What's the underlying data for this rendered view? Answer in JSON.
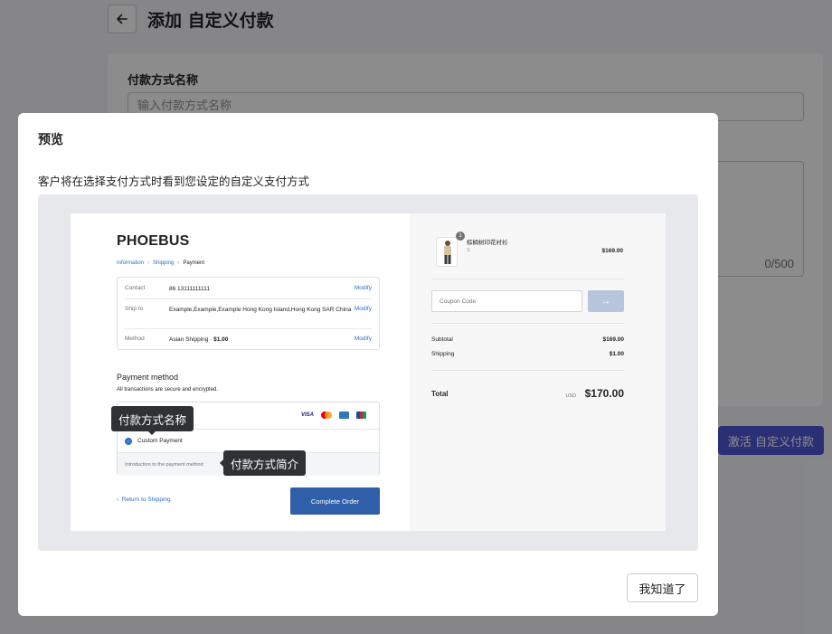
{
  "page": {
    "title": "添加 自定义付款",
    "back_icon": "arrow-left-icon",
    "field_name_label": "付款方式名称",
    "field_name_placeholder": "输入付款方式名称",
    "char_count": "0/500",
    "activate_label": "激活 自定义付款",
    "accent": "#4f57d6"
  },
  "modal": {
    "title": "预览",
    "description": "客户将在选择支付方式时看到您设定的自定义支付方式",
    "ok_label": "我知道了"
  },
  "checkout": {
    "brand": "PHOEBUS",
    "breadcrumb": {
      "information": "Information",
      "shipping": "Shipping",
      "payment": "Payment"
    },
    "info": {
      "contact_label": "Contact",
      "contact_value": "86 13111111111",
      "shipto_label": "Ship to",
      "shipto_value": "Example,Example,Example Hong Kong Island,Hong Kong SAR China",
      "method_label": "Method",
      "method_value": "Asian Shipping · ",
      "method_price": "$1.00",
      "modify": "Modify"
    },
    "payment_title": "Payment method",
    "payment_subtitle": "All transactions are secure and encrypted.",
    "payment_option": "Custom Payment",
    "payment_intro": "Introduction to the payment method",
    "card_visa": "VISA",
    "return_label": "Return to Shipping",
    "complete_label": "Complete Order",
    "tooltip_name": "付款方式名称",
    "tooltip_intro": "付款方式简介",
    "order": {
      "qty": "1",
      "product_name": "棕榈树印花衬衫",
      "product_variant": "S",
      "product_price": "$169.00",
      "coupon_placeholder": "Coupon Code",
      "coupon_arrow": "→",
      "subtotal_label": "Subtotal",
      "subtotal_value": "$169.00",
      "shipping_label": "Shipping",
      "shipping_value": "$1.00",
      "total_label": "Total",
      "total_currency": "USD",
      "total_value": "$170.00"
    }
  }
}
